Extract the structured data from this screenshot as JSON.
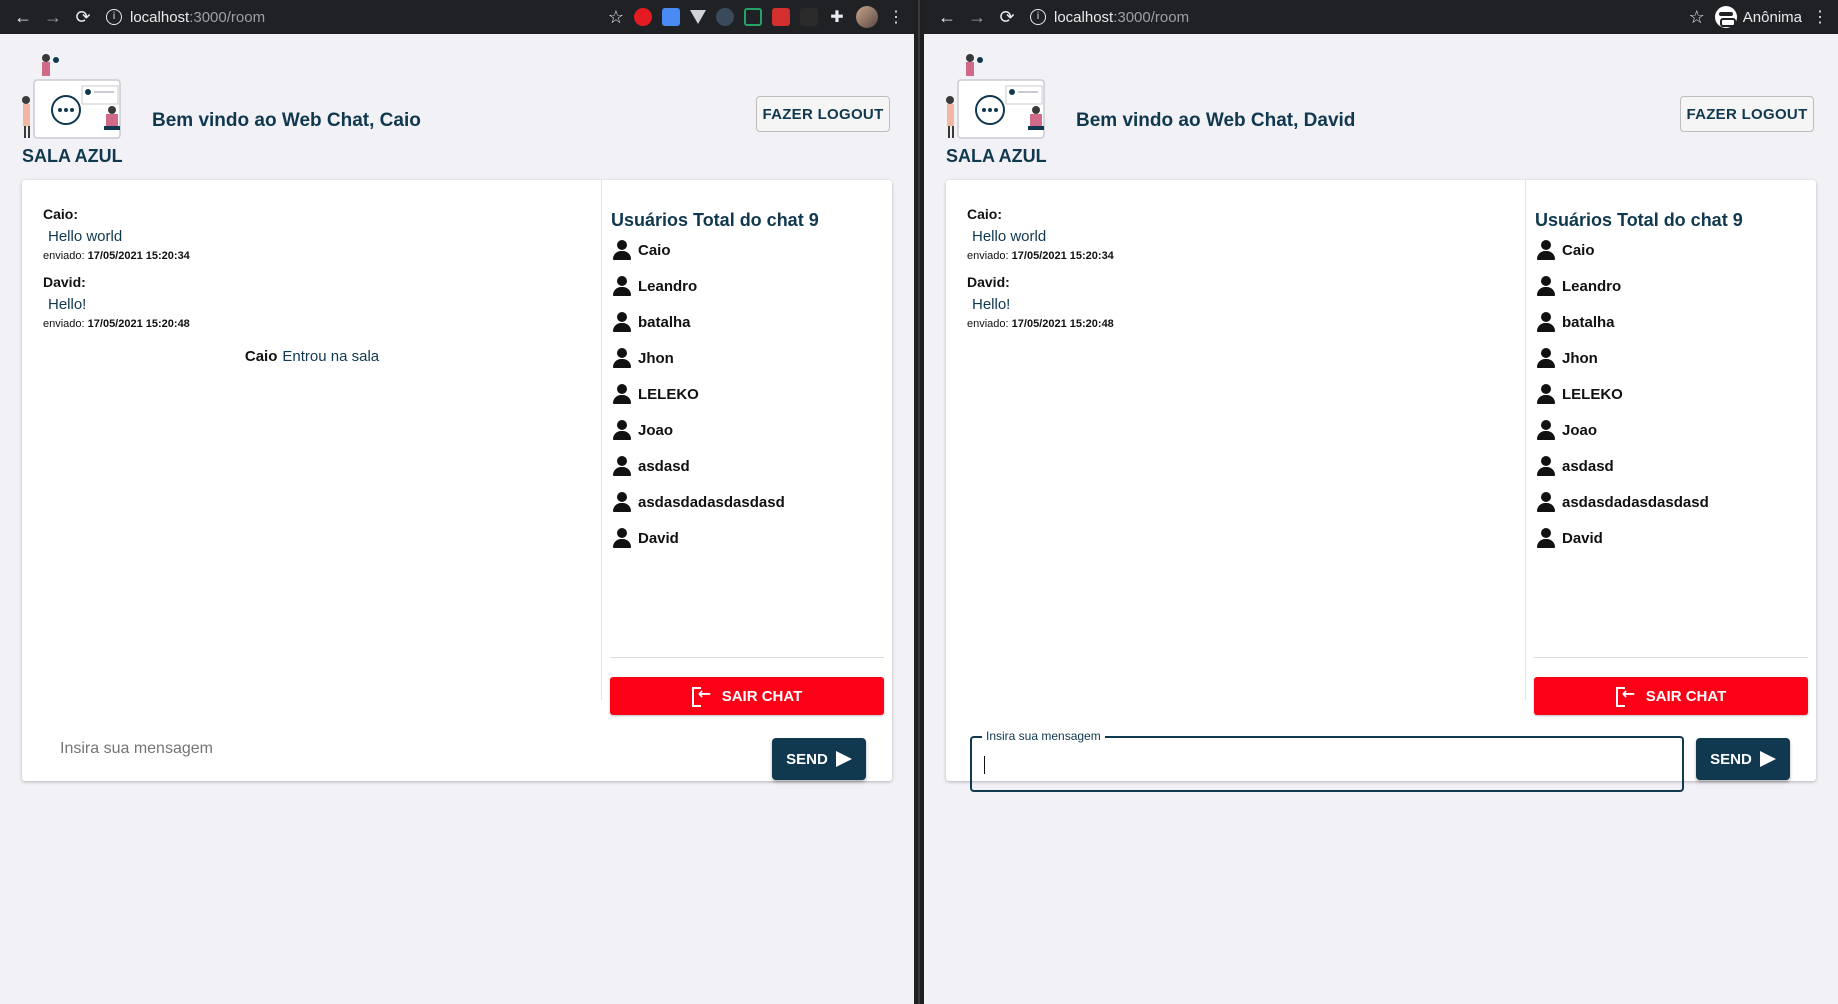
{
  "left": {
    "url": {
      "host": "localhost",
      "path": ":3000/room"
    },
    "welcome": "Bem vindo ao Web Chat, Caio",
    "logout_label": "FAZER LOGOUT",
    "room": "SALA AZUL",
    "messages": [
      {
        "author": "Caio:",
        "text": "Hello world",
        "sent_label": "enviado:",
        "sent_at": "17/05/2021 15:20:34"
      },
      {
        "author": "David:",
        "text": "Hello!",
        "sent_label": "enviado:",
        "sent_at": "17/05/2021 15:20:48"
      }
    ],
    "join_notice": {
      "user": "Caio",
      "action": "Entrou na sala"
    },
    "users_title": "Usuários Total do chat 9",
    "users": [
      "Caio",
      "Leandro",
      "batalha",
      "Jhon",
      "LELEKO",
      "Joao",
      "asdasd",
      "asdasdadasdasdasd",
      "David"
    ],
    "exit_label": "SAIR CHAT",
    "input_placeholder": "Insira sua mensagem",
    "send_label": "SEND"
  },
  "right": {
    "url": {
      "host": "localhost",
      "path": ":3000/room"
    },
    "profile": "Anônima",
    "welcome": "Bem vindo ao Web Chat, David",
    "logout_label": "FAZER LOGOUT",
    "room": "SALA AZUL",
    "messages": [
      {
        "author": "Caio:",
        "text": "Hello world",
        "sent_label": "enviado:",
        "sent_at": "17/05/2021 15:20:34"
      },
      {
        "author": "David:",
        "text": "Hello!",
        "sent_label": "enviado:",
        "sent_at": "17/05/2021 15:20:48"
      }
    ],
    "users_title": "Usuários Total do chat 9",
    "users": [
      "Caio",
      "Leandro",
      "batalha",
      "Jhon",
      "LELEKO",
      "Joao",
      "asdasd",
      "asdasdadasdasdasd",
      "David"
    ],
    "exit_label": "SAIR CHAT",
    "input_label": "Insira sua mensagem",
    "send_label": "SEND"
  },
  "colors": {
    "primary": "#10384f",
    "danger": "#fb0016",
    "background": "#f1f1f6"
  }
}
